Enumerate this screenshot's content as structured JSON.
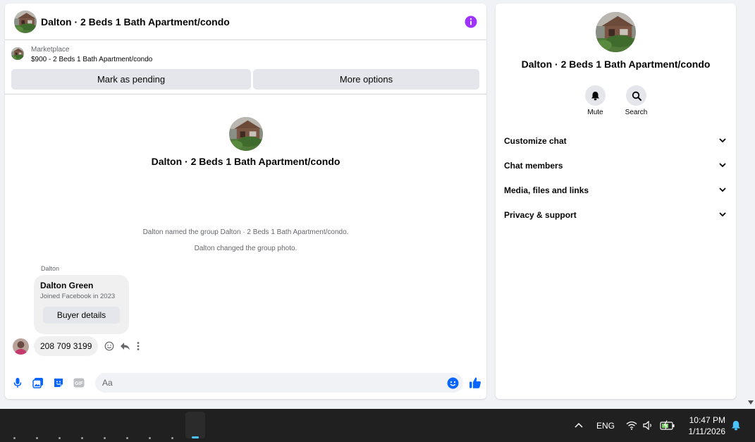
{
  "chat": {
    "header_title": "Dalton · 2 Beds 1 Bath Apartment/condo",
    "listing": {
      "label": "Marketplace",
      "price_title": "$900 - 2 Beds 1 Bath Apartment/condo",
      "pending_label": "Mark as pending",
      "more_label": "More options"
    },
    "intro_title": "Dalton · 2 Beds 1 Bath Apartment/condo",
    "system_messages": [
      "Dalton named the group Dalton · 2 Beds 1 Bath Apartment/condo.",
      "Dalton changed the group photo."
    ],
    "sender_name": "Dalton",
    "card": {
      "name": "Dalton Green",
      "subtitle": "Joined Facebook in 2023",
      "button_label": "Buyer details"
    },
    "phone_message": "208 709 3199",
    "composer_placeholder": "Aa",
    "accent_color": "#0866ff",
    "info_color": "#a033ff"
  },
  "info_panel": {
    "title": "Dalton · 2 Beds 1 Bath Apartment/condo",
    "actions": [
      {
        "label": "Mute",
        "icon": "bell-icon"
      },
      {
        "label": "Search",
        "icon": "search-icon"
      }
    ],
    "sections": [
      "Customize chat",
      "Chat members",
      "Media, files and links",
      "Privacy & support"
    ]
  },
  "taskbar": {
    "language": "ENG",
    "time": "10:47 PM",
    "date": "1/11/2026",
    "icons": [
      "chevron-up-icon",
      "wifi-icon",
      "speaker-icon",
      "battery-icon",
      "notification-bell-icon"
    ]
  }
}
